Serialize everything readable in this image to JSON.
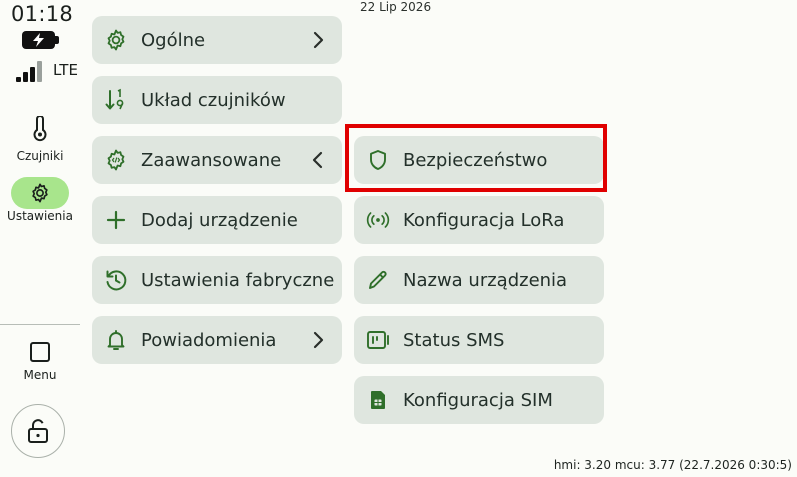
{
  "status": {
    "time": "01:18",
    "network": "LTE",
    "date": "22 Lip 2026"
  },
  "rail": {
    "items": [
      {
        "label": "Czujniki",
        "icon": "thermometer-icon"
      },
      {
        "label": "Ustawienia",
        "icon": "gear-icon",
        "active": true
      }
    ],
    "menu_label": "Menu"
  },
  "settings_menu": {
    "items": [
      {
        "label": "Ogólne",
        "icon": "gear-icon"
      },
      {
        "label": "Układ czujników",
        "icon": "sort-numbers-icon"
      },
      {
        "label": "Zaawansowane",
        "icon": "gear-code-icon"
      },
      {
        "label": "Dodaj urządzenie",
        "icon": "plus-icon"
      },
      {
        "label": "Ustawienia fabryczne",
        "icon": "history-icon"
      },
      {
        "label": "Powiadomienia",
        "icon": "bell-icon"
      }
    ]
  },
  "advanced_menu": {
    "items": [
      {
        "label": "Bezpieczeństwo",
        "icon": "shield-icon"
      },
      {
        "label": "Konfiguracja LoRa",
        "icon": "radio-waves-icon"
      },
      {
        "label": "Nazwa urządzenia",
        "icon": "pencil-icon"
      },
      {
        "label": "Status SMS",
        "icon": "sim-status-icon"
      },
      {
        "label": "Konfiguracja SIM",
        "icon": "sim-card-icon"
      }
    ]
  },
  "footer": {
    "version": "hmi: 3.20 mcu: 3.77 (22.7.2026 0:30:5)"
  },
  "colors": {
    "accent": "#2f6f2a",
    "card": "#dfe6df",
    "active_pill": "#a8e58c",
    "highlight": "#e00000"
  }
}
